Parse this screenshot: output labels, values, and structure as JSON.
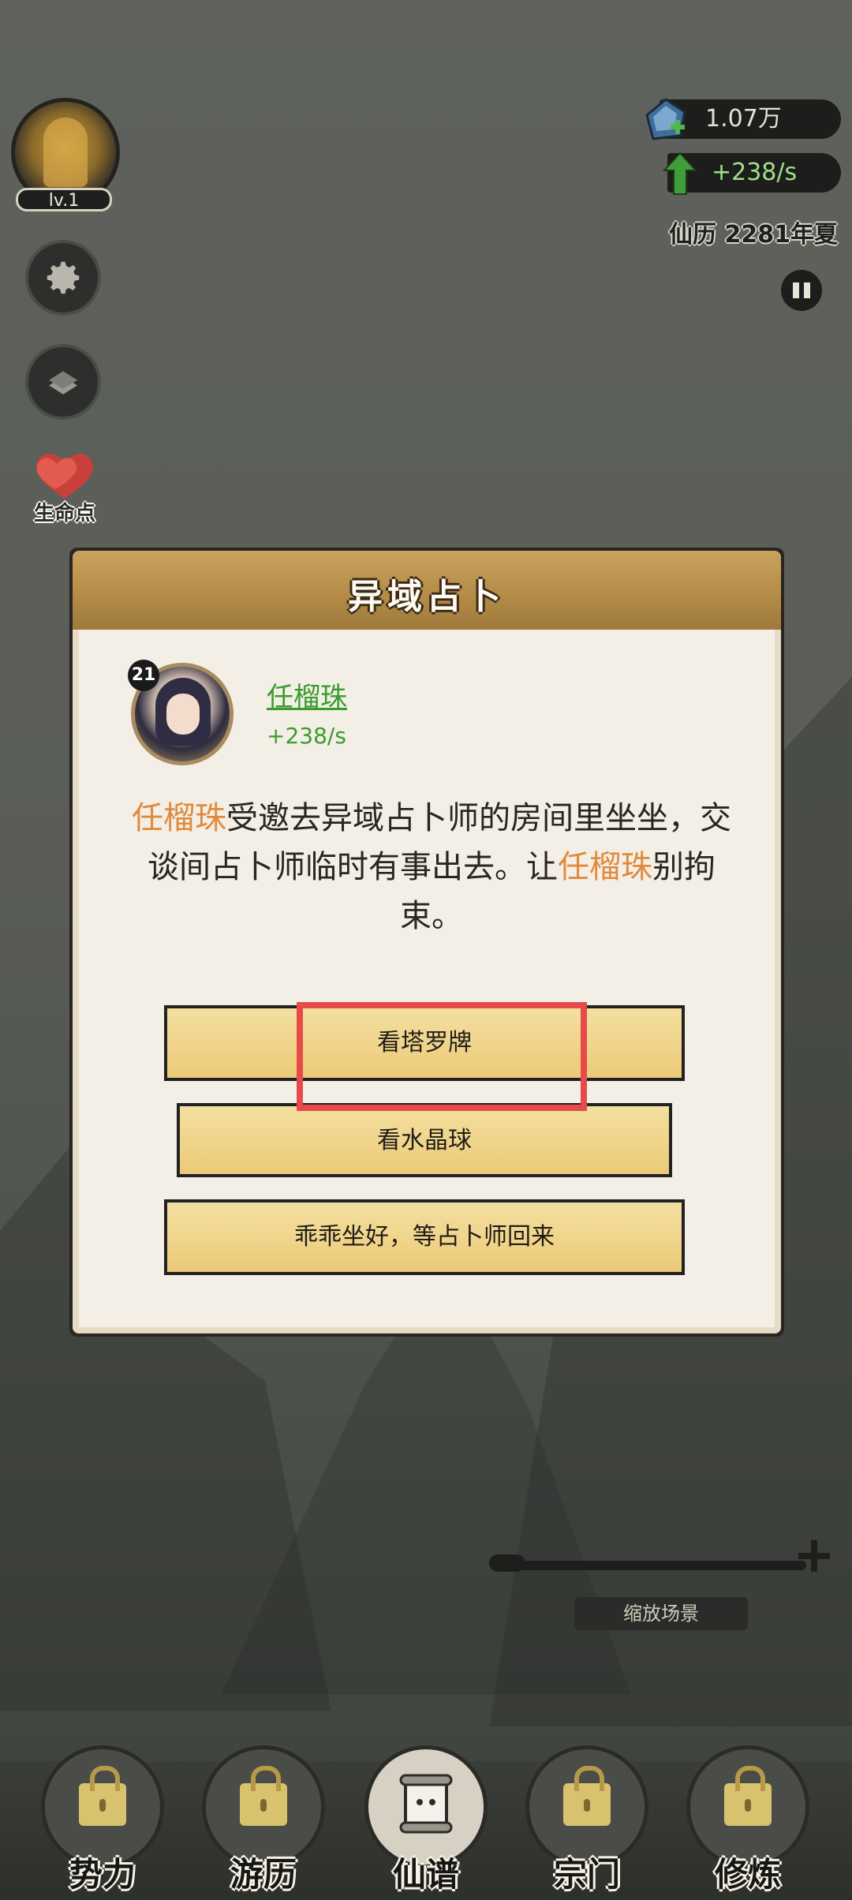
{
  "player": {
    "level": "lv.1"
  },
  "resources": {
    "crystal": "1.07万",
    "rate": "+238/s"
  },
  "calendar": "仙历 2281年夏",
  "side": {
    "life_label": "生命点"
  },
  "dialog": {
    "title": "异域占卜",
    "character": {
      "badge": "21",
      "name": "任榴珠",
      "rate": "+238/s"
    },
    "story": {
      "name1": "任榴珠",
      "text1": "受邀去异域占卜师的房间里坐坐，交谈间占卜师临时有事出去。让",
      "name2": "任榴珠",
      "text2": "别拘束。"
    },
    "choices": [
      "看塔罗牌",
      "看水晶球",
      "乖乖坐好，等占卜师回来"
    ]
  },
  "zoom": {
    "label": "缩放场景"
  },
  "nav": [
    {
      "label": "势力"
    },
    {
      "label": "游历"
    },
    {
      "label": "仙谱"
    },
    {
      "label": "宗门"
    },
    {
      "label": "修炼"
    }
  ],
  "colors": {
    "highlight": "#e64a4a",
    "accent_name": "#e28a3c",
    "green_text": "#3a9c2c"
  }
}
